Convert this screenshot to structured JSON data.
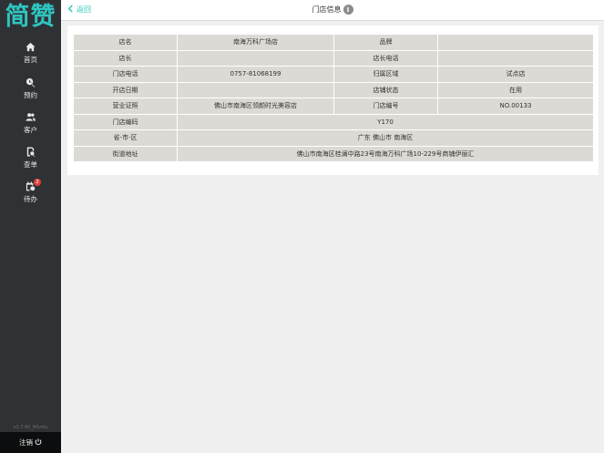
{
  "sidebar": {
    "logo": "简赞",
    "items": [
      {
        "label": "首页",
        "icon": "home-icon"
      },
      {
        "label": "预约",
        "icon": "appointment-icon"
      },
      {
        "label": "客户",
        "icon": "customers-icon"
      },
      {
        "label": "查单",
        "icon": "orders-icon"
      },
      {
        "label": "待办",
        "icon": "todo-icon",
        "badge": "2"
      }
    ],
    "version": "v1.7.60_80vrtu",
    "logout": "注销"
  },
  "header": {
    "back": "返回",
    "title": "门店信息",
    "info_icon": "i"
  },
  "store": {
    "name_label": "店名",
    "name": "南海万科广场店",
    "brand_label": "品牌",
    "brand": "",
    "manager_label": "店长",
    "manager": "",
    "manager_phone_label": "店长电话",
    "manager_phone": "",
    "phone_label": "门店电话",
    "phone": "0757-81068199",
    "region_label": "归属区域",
    "region": "试点店",
    "open_date_label": "开店日期",
    "open_date": "",
    "status_label": "店铺状态",
    "status": "在用",
    "license_label": "营业证照",
    "license": "佛山市南海区领颜时光美容店",
    "store_no_label": "门店编号",
    "store_no": "NO.00133",
    "code_label": "门店编码",
    "code": "Y170",
    "area_label": "省-市-区",
    "area": "广东 佛山市 南海区",
    "address_label": "街道地址",
    "address": "佛山市南海区桂澜中路23号南海万科广场10-229号商铺伊丽汇"
  },
  "colors": {
    "accent": "#2ec5c0",
    "sidebar": "#2f3235",
    "cell": "#dcdad5",
    "badge": "#e0403a"
  }
}
